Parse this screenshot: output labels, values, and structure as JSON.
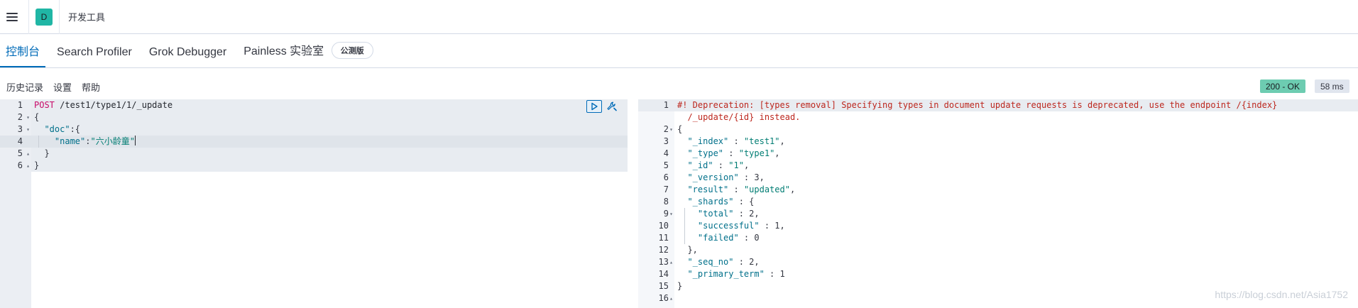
{
  "header": {
    "space_initial": "D",
    "breadcrumb": "开发工具"
  },
  "tabs": [
    {
      "label": "控制台",
      "active": true
    },
    {
      "label": "Search Profiler"
    },
    {
      "label": "Grok Debugger"
    },
    {
      "label": "Painless 实验室",
      "badge": "公测版"
    }
  ],
  "toolbar": {
    "history": "历史记录",
    "settings": "设置",
    "help": "帮助"
  },
  "response_status": {
    "code": "200 - OK",
    "time": "58 ms",
    "ok_color": "#6dccb1"
  },
  "request_editor": {
    "lines": [
      {
        "n": "1",
        "fold": ""
      },
      {
        "n": "2",
        "fold": "▾"
      },
      {
        "n": "3",
        "fold": "▾"
      },
      {
        "n": "4",
        "fold": ""
      },
      {
        "n": "5",
        "fold": "▴"
      },
      {
        "n": "6",
        "fold": "▴"
      }
    ],
    "method": "POST",
    "url": " /test1/type1/1/_update",
    "open_brace": "{",
    "doc_key": "\"doc\"",
    "doc_colon": ":{",
    "name_key": "\"name\"",
    "name_colon": ":",
    "name_value": "\"六小龄童\"",
    "close_inner": "}",
    "close_outer": "}"
  },
  "response_editor": {
    "line_numbers": [
      "1",
      "",
      "2",
      "3",
      "4",
      "5",
      "6",
      "7",
      "8",
      "9",
      "10",
      "11",
      "12",
      "13",
      "14",
      "15",
      "16"
    ],
    "folds": [
      "",
      "",
      "▾",
      "",
      "",
      "",
      "",
      "",
      "",
      "▾",
      "",
      "",
      "",
      "▴",
      "",
      "",
      "▴"
    ],
    "warning_1": "#! Deprecation: [types removal] Specifying types in document update requests is deprecated, use the endpoint /{index}",
    "warning_2": "/_update/{id} instead.",
    "open": "{",
    "k_index": "\"_index\"",
    "v_index": "\"test1\"",
    "k_type": "\"_type\"",
    "v_type": "\"type1\"",
    "k_id": "\"_id\"",
    "v_id": "\"1\"",
    "k_version": "\"_version\"",
    "v_version": "3",
    "k_result": "\"result\"",
    "v_result": "\"updated\"",
    "k_shards": "\"_shards\"",
    "k_total": "\"total\"",
    "v_total": "2",
    "k_successful": "\"successful\"",
    "v_successful": "1",
    "k_failed": "\"failed\"",
    "v_failed": "0",
    "close_shards": "},",
    "k_seq": "\"_seq_no\"",
    "v_seq": "2",
    "k_primary": "\"_primary_term\"",
    "v_primary": "1",
    "close": "}"
  },
  "actions": {
    "play_icon": "play-icon",
    "wrench_icon": "wrench-icon"
  },
  "watermark": "https://blog.csdn.net/Asia1752"
}
